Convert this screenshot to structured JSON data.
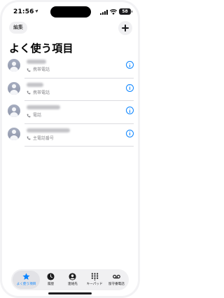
{
  "status_bar": {
    "time": "21:56",
    "battery": "58"
  },
  "header": {
    "edit_label": "編集",
    "title": "よく使う項目"
  },
  "favorites": [
    {
      "type": "携帯電話",
      "icon": "phone-icon"
    },
    {
      "type": "携帯電話",
      "icon": "phone-icon"
    },
    {
      "type": "電話",
      "icon": "phone-icon"
    },
    {
      "type": "主電話番号",
      "icon": "phone-icon"
    }
  ],
  "tab_bar": {
    "tabs": [
      {
        "label": "よく使う項目",
        "icon": "star-icon",
        "active": true
      },
      {
        "label": "履歴",
        "icon": "clock-icon",
        "active": false
      },
      {
        "label": "連絡先",
        "icon": "person-icon",
        "active": false
      },
      {
        "label": "キーパッド",
        "icon": "keypad-icon",
        "active": false
      },
      {
        "label": "留守番電話",
        "icon": "voicemail-icon",
        "active": false
      }
    ]
  },
  "colors": {
    "accent": "#0a84ff",
    "secondary_text": "#8a8a8e",
    "background": "#ffffff"
  }
}
